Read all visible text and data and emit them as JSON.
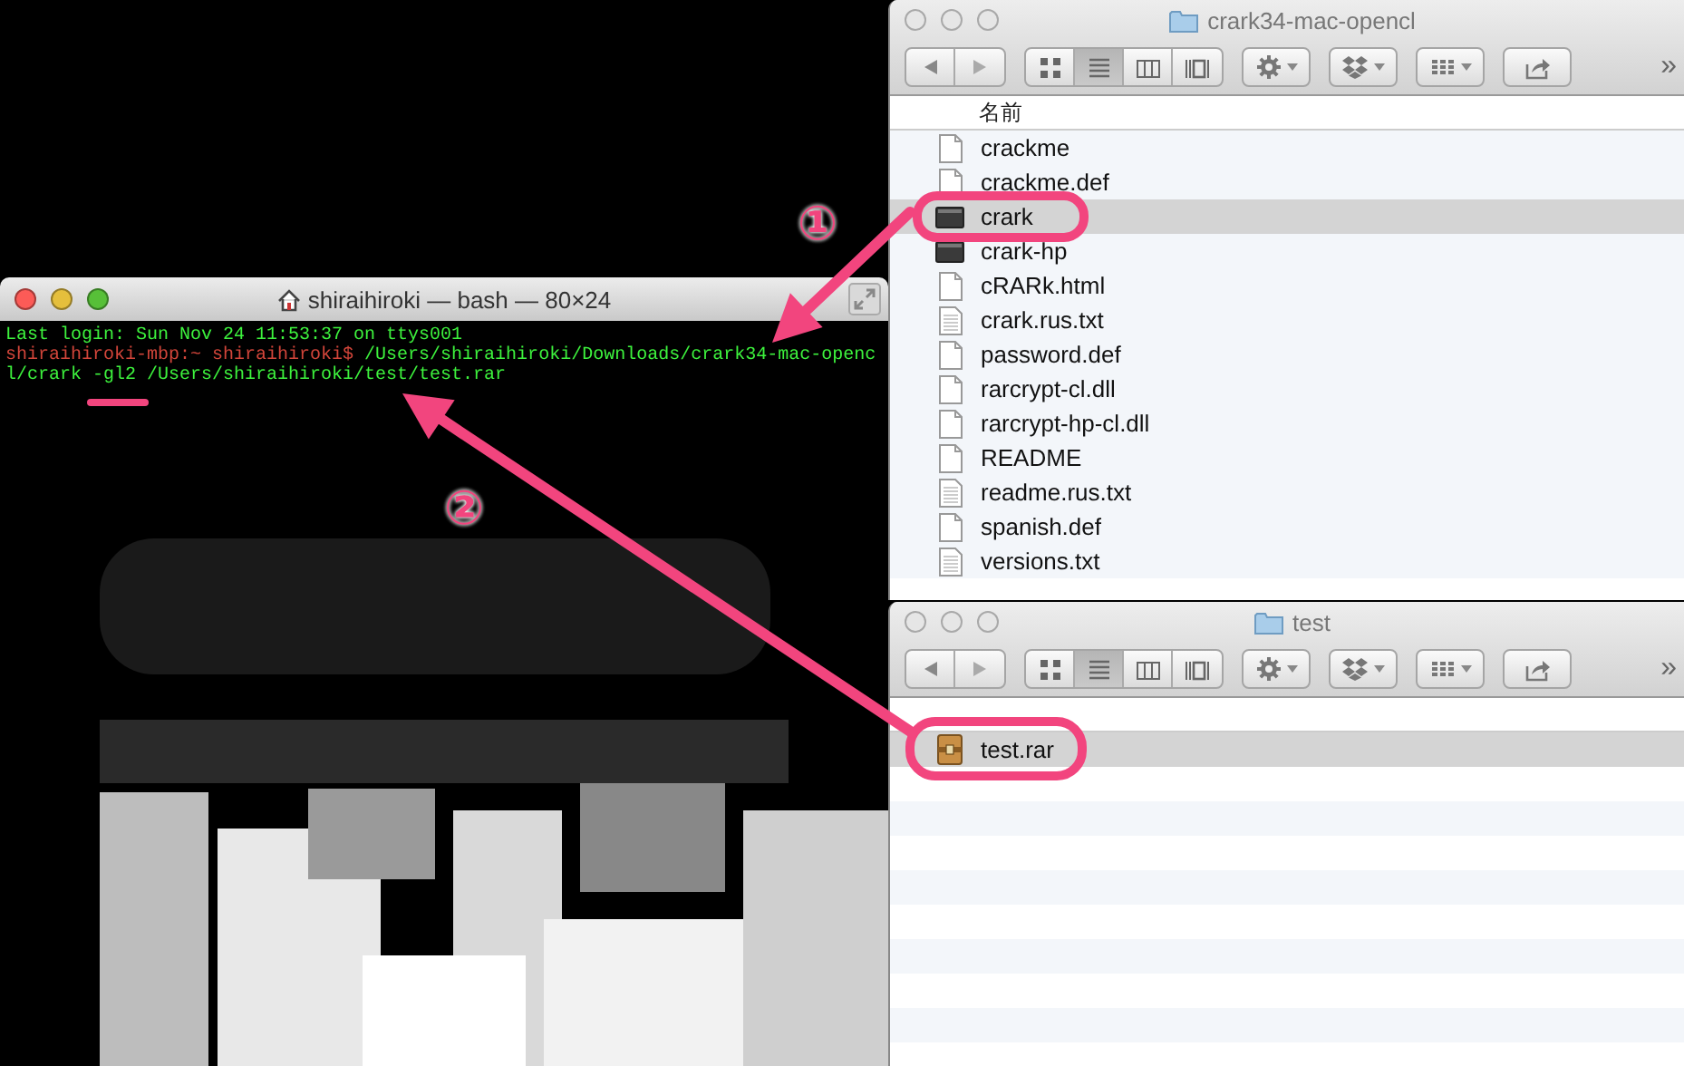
{
  "terminal": {
    "title": "shiraihiroki — bash — 80×24",
    "active": true,
    "lines": [
      {
        "segments": [
          {
            "kind": "output",
            "text": "Last login: Sun Nov 24 11:53:37 on ttys001"
          }
        ]
      },
      {
        "segments": [
          {
            "kind": "prompt",
            "text": "shiraihiroki-mbp:~ shiraihiroki$ "
          },
          {
            "kind": "output",
            "text": "/Users/shiraihiroki/Downloads/crark34-mac-openc"
          }
        ]
      },
      {
        "segments": [
          {
            "kind": "output",
            "text": "l/crark -gl2 /Users/shiraihiroki/test/test.rar"
          }
        ]
      }
    ]
  },
  "finders": [
    {
      "title": "crark34-mac-opencl",
      "active": false,
      "view_buttons": [
        {
          "selected": false
        },
        {
          "selected": true
        },
        {
          "selected": false
        },
        {
          "selected": false
        }
      ],
      "overflow": "»",
      "column_header": "名前",
      "files": [
        {
          "name": "crackme",
          "kind": "document",
          "selected": false
        },
        {
          "name": "crackme.def",
          "kind": "document",
          "selected": false
        },
        {
          "name": "crark",
          "kind": "executable",
          "selected": true
        },
        {
          "name": "crark-hp",
          "kind": "executable",
          "selected": false
        },
        {
          "name": "cRARk.html",
          "kind": "document",
          "selected": false
        },
        {
          "name": "crark.rus.txt",
          "kind": "text",
          "selected": false
        },
        {
          "name": "password.def",
          "kind": "document",
          "selected": false
        },
        {
          "name": "rarcrypt-cl.dll",
          "kind": "document",
          "selected": false
        },
        {
          "name": "rarcrypt-hp-cl.dll",
          "kind": "document",
          "selected": false
        },
        {
          "name": "README",
          "kind": "document",
          "selected": false
        },
        {
          "name": "readme.rus.txt",
          "kind": "text",
          "selected": false
        },
        {
          "name": "spanish.def",
          "kind": "document",
          "selected": false
        },
        {
          "name": "versions.txt",
          "kind": "text",
          "selected": false
        }
      ]
    },
    {
      "title": "test",
      "active": false,
      "view_buttons": [
        {
          "selected": false
        },
        {
          "selected": true
        },
        {
          "selected": false
        },
        {
          "selected": false
        }
      ],
      "overflow": "»",
      "files": [
        {
          "name": "test.rar",
          "kind": "archive",
          "selected": true
        }
      ]
    }
  ],
  "annotations": [
    {
      "kind": "number",
      "text": "①"
    },
    {
      "kind": "number",
      "text": "②"
    }
  ]
}
